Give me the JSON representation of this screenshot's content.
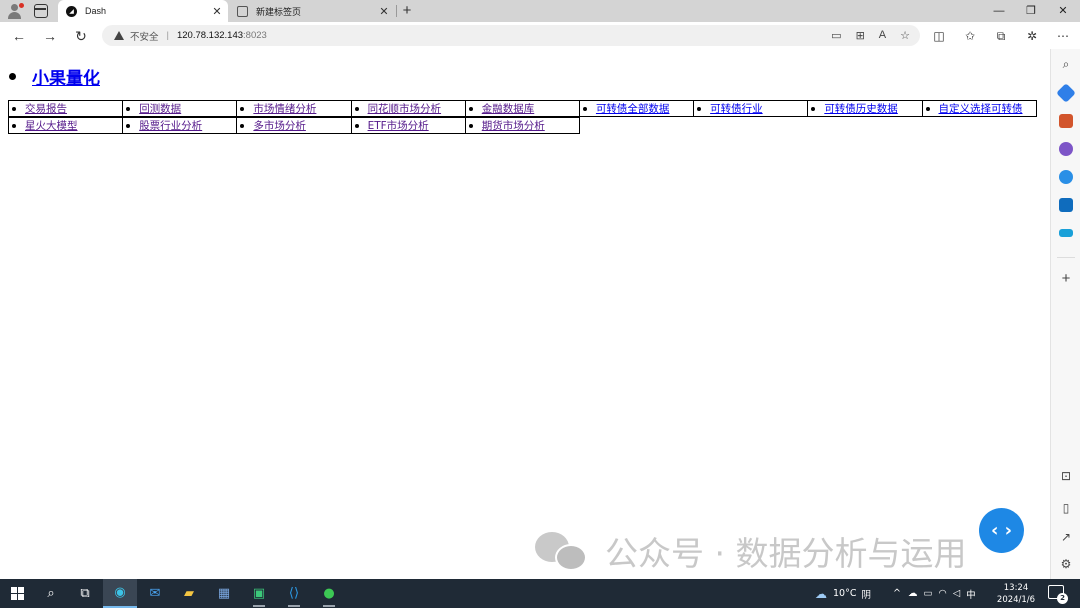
{
  "browser": {
    "tabs": [
      {
        "title": "Dash",
        "active": true
      },
      {
        "title": "新建标签页",
        "active": false
      }
    ],
    "new_tab_glyph": "+",
    "address": {
      "security_label": "不安全",
      "host": "120.78.132.143",
      "port": ":8023"
    },
    "window_controls": {
      "minimize": "—",
      "restore": "❐",
      "close": "✕"
    }
  },
  "page": {
    "brand": "小果量化",
    "nav_rows": [
      [
        "交易报告",
        "回测数据",
        "市场情绪分析",
        "同花顺市场分析",
        "金融数据库",
        "可转债全部数据",
        "可转债行业",
        "可转债历史数据",
        "自定义选择可转债"
      ],
      [
        "星火大模型",
        "股票行业分析",
        "多市场分析",
        "ETF市场分析",
        "期货市场分析"
      ]
    ],
    "fab_label": "‹ ›"
  },
  "watermark": {
    "text": "公众号 · 数据分析与运用"
  },
  "taskbar": {
    "weather": {
      "temp": "10°C",
      "condition": "阴"
    },
    "ime": "中",
    "clock_time": "13:24",
    "clock_date": "2024/1/6",
    "notification_count": "2"
  }
}
